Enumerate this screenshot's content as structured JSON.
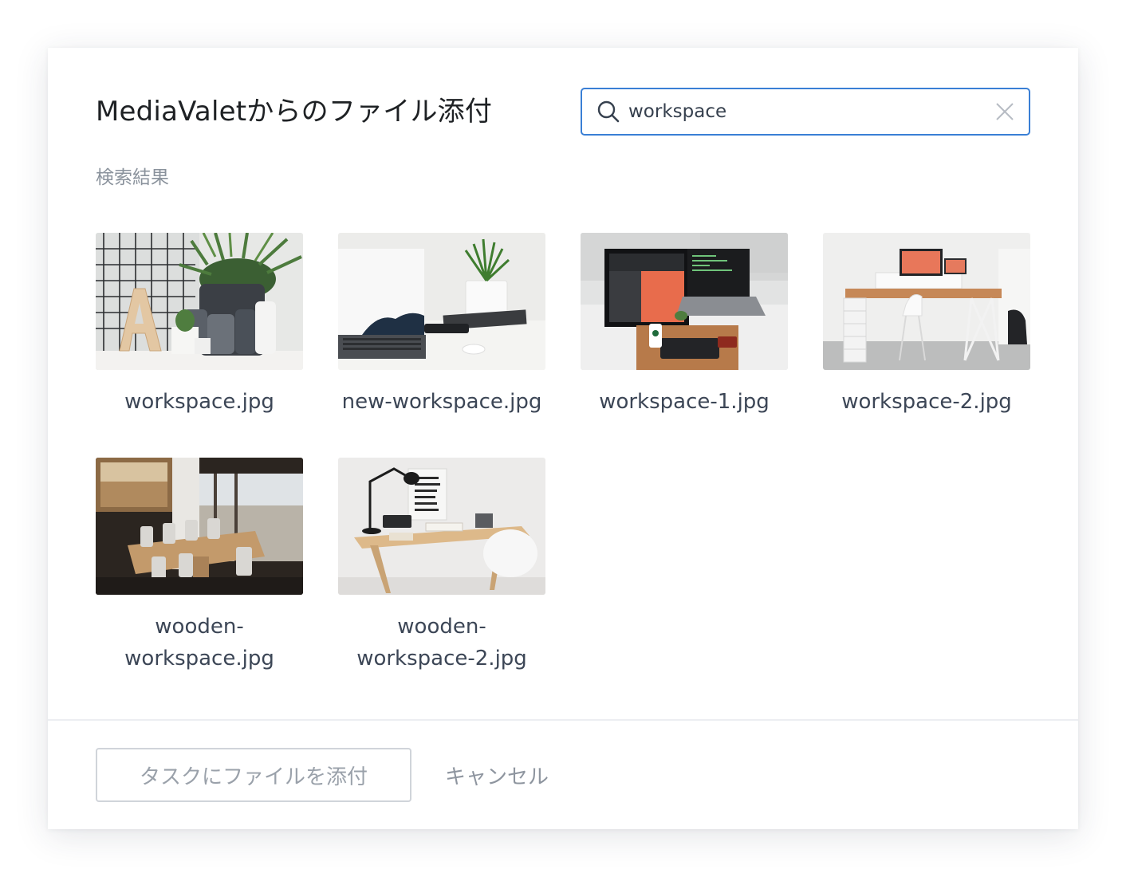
{
  "dialog": {
    "title": "MediaValetからのファイル添付",
    "results_label": "検索結果"
  },
  "search": {
    "value": "workspace",
    "icon": "search-icon",
    "clear_icon": "close-icon"
  },
  "files": [
    {
      "name": "workspace.jpg",
      "name_lines": [
        "workspace.jpg"
      ]
    },
    {
      "name": "new-workspace.jpg",
      "name_lines": [
        "new-workspace.jpg"
      ]
    },
    {
      "name": "workspace-1.jpg",
      "name_lines": [
        "workspace-1.jpg"
      ]
    },
    {
      "name": "workspace-2.jpg",
      "name_lines": [
        "workspace-2.jpg"
      ]
    },
    {
      "name": "wooden-workspace.jpg",
      "name_lines": [
        "wooden-",
        "workspace.jpg"
      ]
    },
    {
      "name": "wooden-workspace-2.jpg",
      "name_lines": [
        "wooden-",
        "workspace-2.jpg"
      ]
    }
  ],
  "footer": {
    "attach_label": "タスクにファイルを添付",
    "cancel_label": "キャンセル"
  },
  "colors": {
    "accent": "#3a7fd5",
    "title_text": "#1e2124",
    "muted_text": "#8a929c",
    "filename_text": "#3c4656"
  }
}
